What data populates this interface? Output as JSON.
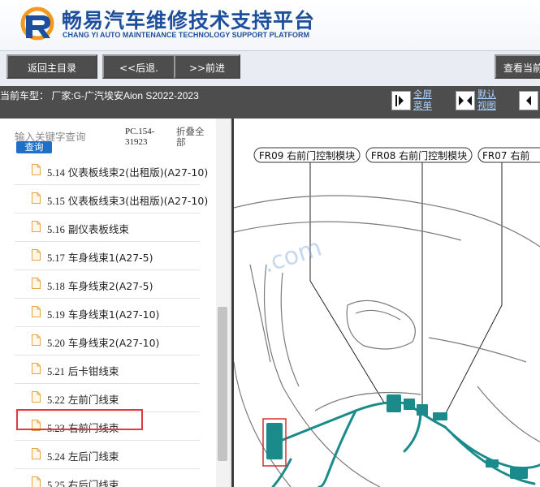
{
  "header": {
    "title_cn": "畅易汽车维修技术支持平台",
    "title_en": "CHANG YI AUTO MAINTENANCE TECHNOLOGY SUPPORT PLATFORM"
  },
  "toolbar": {
    "back_home": "返回主目录",
    "prev": "<<后退.",
    "next": ">>前进",
    "view_current": "查看当前"
  },
  "info": {
    "vehicle": "当前车型： 厂家:G-广汽埃安Aion S2022-2023",
    "fullscreen_line1": "全屏",
    "fullscreen_line2": "菜单",
    "default_line1": "默认",
    "default_line2": "视图"
  },
  "search": {
    "placeholder": "输入关键字查询",
    "button": "查询"
  },
  "doc_code_line1": "PC.154-",
  "doc_code_line2": "31923",
  "collapse_line1": "折叠全",
  "collapse_line2": "部",
  "items": [
    {
      "num": "5.14",
      "label": "仪表板线束2(出租版)(A27-10)"
    },
    {
      "num": "5.15",
      "label": "仪表板线束3(出租版)(A27-10)"
    },
    {
      "num": "5.16",
      "label": "副仪表板线束"
    },
    {
      "num": "5.17",
      "label": "车身线束1(A27-5)"
    },
    {
      "num": "5.18",
      "label": "车身线束2(A27-5)"
    },
    {
      "num": "5.19",
      "label": "车身线束1(A27-10)"
    },
    {
      "num": "5.20",
      "label": "车身线束2(A27-10)"
    },
    {
      "num": "5.21",
      "label": "后卡钳线束"
    },
    {
      "num": "5.22",
      "label": "左前门线束"
    },
    {
      "num": "5.23",
      "label": "右前门线束"
    },
    {
      "num": "5.24",
      "label": "左后门线束"
    },
    {
      "num": "5.25",
      "label": "右后门线束"
    }
  ],
  "selected_item": "5.23",
  "diagram": {
    "labels": [
      "FR09 右前门控制模块",
      "FR08 右前门控制模块",
      "FR07 右前"
    ],
    "watermark": ".com"
  },
  "colors": {
    "header_blue": "#1d4f9c",
    "toolbar_button": "#4d4d4d",
    "search_button": "#1e6fc8",
    "highlight_red": "#e0393e",
    "harness_teal": "#1a8a8a"
  }
}
